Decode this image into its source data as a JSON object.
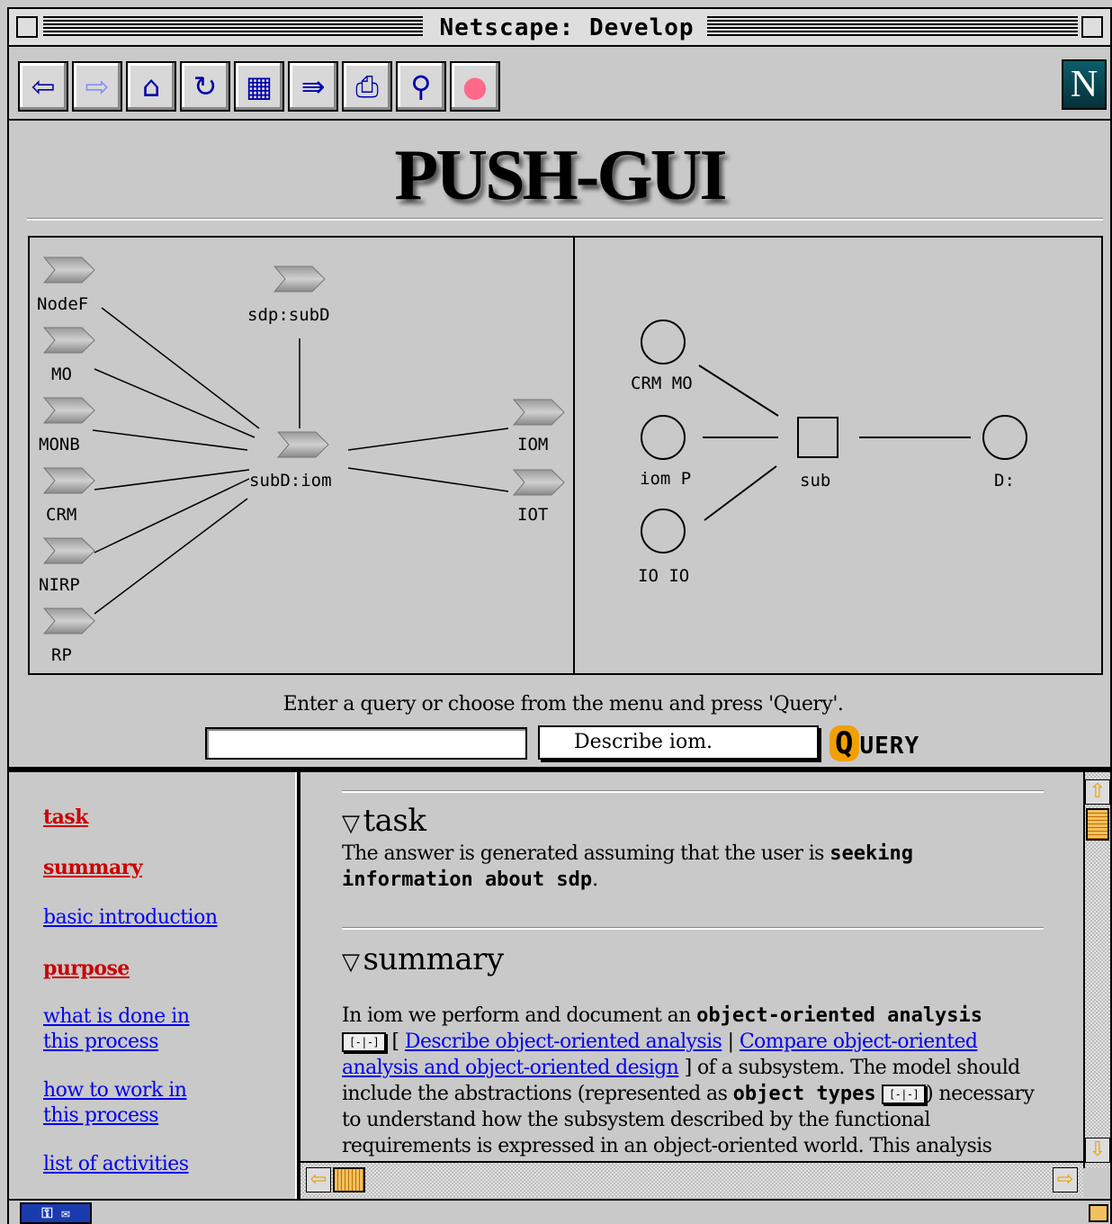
{
  "window": {
    "title": "Netscape: Develop"
  },
  "toolbar": {
    "buttons": [
      {
        "icon": "back-icon",
        "glyph": "⇦"
      },
      {
        "icon": "forward-icon",
        "glyph": "⇨"
      },
      {
        "icon": "home-icon",
        "glyph": "⌂"
      },
      {
        "icon": "reload-icon",
        "glyph": "↻"
      },
      {
        "icon": "images-icon",
        "glyph": "▦"
      },
      {
        "icon": "open-icon",
        "glyph": "⇛"
      },
      {
        "icon": "print-icon",
        "glyph": "⎙"
      },
      {
        "icon": "find-icon",
        "glyph": "⚲"
      },
      {
        "icon": "stop-icon",
        "glyph": "●"
      }
    ],
    "logo": "N"
  },
  "banner": {
    "title": "PUSH-GUI"
  },
  "graph_left": {
    "nodes": [
      "NodeF",
      "MO",
      "MONB",
      "CRM",
      "NIRP",
      "RP",
      "sdp:subD",
      "subD:iom",
      "IOM",
      "IOT"
    ]
  },
  "graph_right": {
    "nodes": [
      "CRM MO",
      "iom P",
      "IO IO",
      "sub",
      "D:"
    ]
  },
  "query": {
    "prompt": "Enter a query or choose from the menu and press 'Query'.",
    "input_value": "",
    "selected_option": "Describe iom.",
    "button_q": "Q",
    "button_rest": "UERY"
  },
  "nav": {
    "links": [
      {
        "label": "task",
        "active": true
      },
      {
        "label": "summary",
        "active": true
      },
      {
        "label": "basic introduction",
        "active": false
      },
      {
        "label": "purpose",
        "active": true
      },
      {
        "label": "what is done in",
        "label2": "this process",
        "active": false
      },
      {
        "label": "how to work in",
        "label2": "this process",
        "active": false
      },
      {
        "label": "list of activities",
        "active": false
      }
    ]
  },
  "content": {
    "task": {
      "heading": "task",
      "text_pre": "The answer is generated assuming that the user is ",
      "text_bold": "seeking information about sdp",
      "text_post": "."
    },
    "summary": {
      "heading": "summary",
      "p1_pre": "In iom we perform and document an ",
      "p1_bold": "object-oriented analysis",
      "mini_button": "[-|-]",
      "link1": "Describe object-oriented analysis",
      "separator": "|",
      "link2": "Compare object-oriented analysis and object-oriented design",
      "p1_mid": "] of a subsystem. The model should include the abstractions (represented as ",
      "p1_bold2": "object types",
      "p1_post": ") necessary to understand how the subsystem described by the functional requirements is expressed in an object-oriented world. This analysis"
    }
  },
  "colors": {
    "link": "#0000ee",
    "active_link": "#cc0000",
    "background": "#c9c9c9",
    "scroll_accent": "#e8a000"
  }
}
